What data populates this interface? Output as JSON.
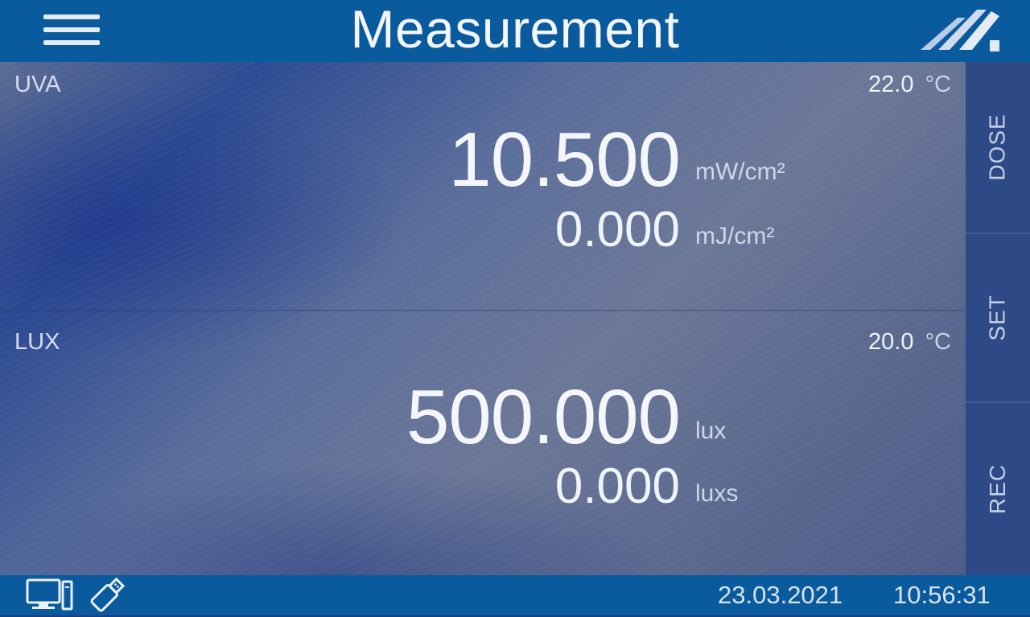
{
  "header": {
    "title": "Measurement",
    "menu_icon": "hamburger-menu-icon",
    "logo_icon": "brand-logo-icon"
  },
  "channels": [
    {
      "name": "UVA",
      "temperature": "22.0",
      "temperature_unit": "°C",
      "primary_value": "10.500",
      "primary_unit": "mW/cm²",
      "secondary_value": "0.000",
      "secondary_unit": "mJ/cm²"
    },
    {
      "name": "LUX",
      "temperature": "20.0",
      "temperature_unit": "°C",
      "primary_value": "500.000",
      "primary_unit": "lux",
      "secondary_value": "0.000",
      "secondary_unit": "luxs"
    }
  ],
  "sidebar": {
    "buttons": [
      {
        "label": "DOSE"
      },
      {
        "label": "SET"
      },
      {
        "label": "REC"
      }
    ]
  },
  "statusbar": {
    "date": "23.03.2021",
    "time": "10:56:31",
    "icons": [
      "computer-icon",
      "usb-stick-icon"
    ]
  },
  "colors": {
    "bar": "#0a5a9e",
    "sidebar": "#2e4a86",
    "text": "#f3f6fb"
  }
}
